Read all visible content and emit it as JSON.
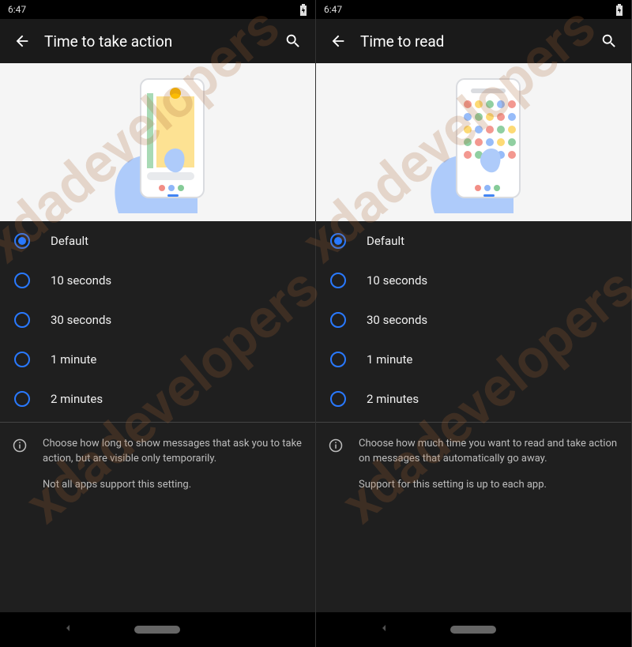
{
  "panes": [
    {
      "status": {
        "time": "6:47"
      },
      "appbar": {
        "title": "Time to take action"
      },
      "options": [
        {
          "label": "Default"
        },
        {
          "label": "10 seconds"
        },
        {
          "label": "30 seconds"
        },
        {
          "label": "1 minute"
        },
        {
          "label": "2 minutes"
        }
      ],
      "info": {
        "line1": "Choose how long to show messages that ask you to take action, but are visible only temporarily.",
        "line2": "Not all apps support this setting."
      }
    },
    {
      "status": {
        "time": "6:47"
      },
      "appbar": {
        "title": "Time to read"
      },
      "options": [
        {
          "label": "Default"
        },
        {
          "label": "10 seconds"
        },
        {
          "label": "30 seconds"
        },
        {
          "label": "1 minute"
        },
        {
          "label": "2 minutes"
        }
      ],
      "info": {
        "line1": "Choose how much time you want to read and take action on messages that automatically go away.",
        "line2": "Support for this setting is up to each app."
      }
    }
  ],
  "watermark": "xdadevelopers"
}
